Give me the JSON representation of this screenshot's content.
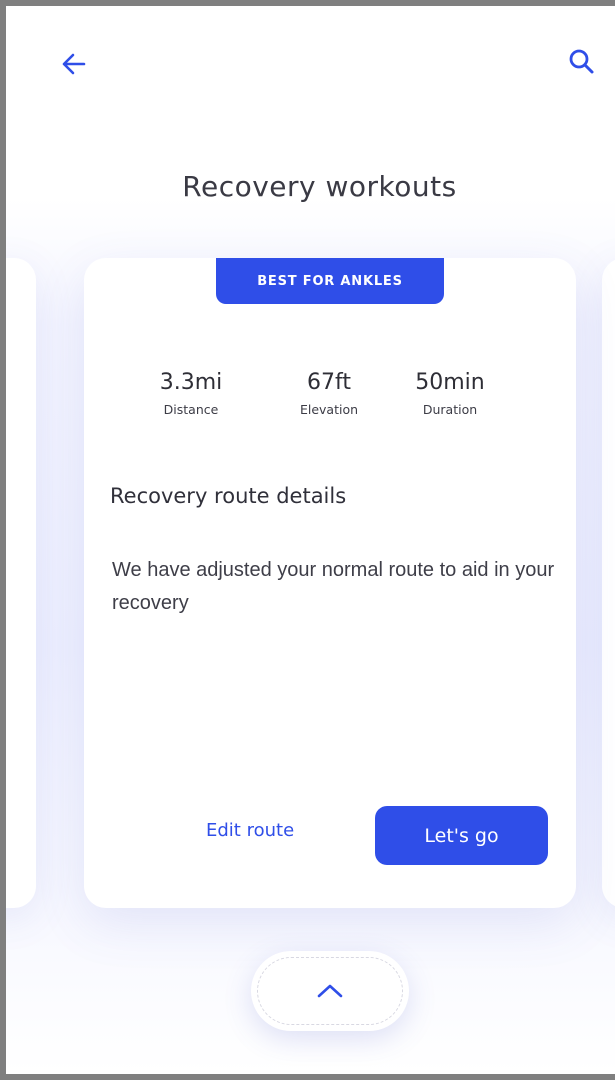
{
  "header": {
    "back_icon": "arrow-left-icon",
    "search_icon": "search-icon",
    "title": "Recovery workouts"
  },
  "colors": {
    "accent": "#2f4ee8",
    "text_dark": "#30303a",
    "background_tint": "#eef0ff"
  },
  "card": {
    "badge": "BEST FOR ANKLES",
    "stats": [
      {
        "value": "3.3mi",
        "label": "Distance"
      },
      {
        "value": "67ft",
        "label": "Elevation"
      },
      {
        "value": "50min",
        "label": "Duration"
      }
    ],
    "details_title": "Recovery route details",
    "details_text": "We have adjusted your normal route to aid in your recovery",
    "edit_label": "Edit route",
    "go_label": "Let's go"
  },
  "footer": {
    "expand_icon": "chevron-up-icon"
  }
}
